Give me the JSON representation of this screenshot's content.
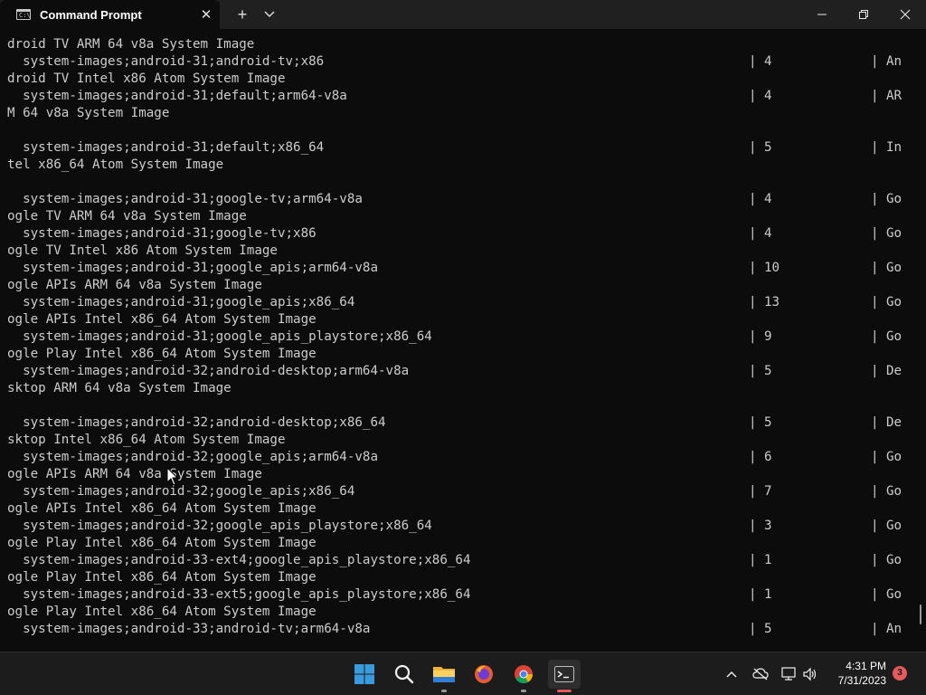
{
  "titlebar": {
    "tab_title": "Command Prompt",
    "tab_icon_text": "C:\\",
    "close_tab_glyph": "✕",
    "new_tab_glyph": "+",
    "dropdown_glyph": "⌄",
    "minimize_glyph": "—",
    "maximize_glyph": "❐",
    "close_glyph": "✕"
  },
  "terminal": {
    "lines": [
      {
        "text": "droid TV ARM 64 v8a System Image"
      },
      {
        "text": "  system-images;android-31;android-tv;x86",
        "count": "4",
        "desc": "An"
      },
      {
        "text": "droid TV Intel x86 Atom System Image"
      },
      {
        "text": "  system-images;android-31;default;arm64-v8a",
        "count": "4",
        "desc": "AR"
      },
      {
        "text": "M 64 v8a System Image"
      },
      {
        "text": ""
      },
      {
        "text": "  system-images;android-31;default;x86_64",
        "count": "5",
        "desc": "In"
      },
      {
        "text": "tel x86_64 Atom System Image"
      },
      {
        "text": ""
      },
      {
        "text": "  system-images;android-31;google-tv;arm64-v8a",
        "count": "4",
        "desc": "Go"
      },
      {
        "text": "ogle TV ARM 64 v8a System Image"
      },
      {
        "text": "  system-images;android-31;google-tv;x86",
        "count": "4",
        "desc": "Go"
      },
      {
        "text": "ogle TV Intel x86 Atom System Image"
      },
      {
        "text": "  system-images;android-31;google_apis;arm64-v8a",
        "count": "10",
        "desc": "Go"
      },
      {
        "text": "ogle APIs ARM 64 v8a System Image"
      },
      {
        "text": "  system-images;android-31;google_apis;x86_64",
        "count": "13",
        "desc": "Go"
      },
      {
        "text": "ogle APIs Intel x86_64 Atom System Image"
      },
      {
        "text": "  system-images;android-31;google_apis_playstore;x86_64",
        "count": "9",
        "desc": "Go"
      },
      {
        "text": "ogle Play Intel x86_64 Atom System Image"
      },
      {
        "text": "  system-images;android-32;android-desktop;arm64-v8a",
        "count": "5",
        "desc": "De"
      },
      {
        "text": "sktop ARM 64 v8a System Image"
      },
      {
        "text": ""
      },
      {
        "text": "  system-images;android-32;android-desktop;x86_64",
        "count": "5",
        "desc": "De"
      },
      {
        "text": "sktop Intel x86_64 Atom System Image"
      },
      {
        "text": "  system-images;android-32;google_apis;arm64-v8a",
        "count": "6",
        "desc": "Go"
      },
      {
        "text": "ogle APIs ARM 64 v8a System Image"
      },
      {
        "text": "  system-images;android-32;google_apis;x86_64",
        "count": "7",
        "desc": "Go"
      },
      {
        "text": "ogle APIs Intel x86_64 Atom System Image"
      },
      {
        "text": "  system-images;android-32;google_apis_playstore;x86_64",
        "count": "3",
        "desc": "Go"
      },
      {
        "text": "ogle Play Intel x86_64 Atom System Image"
      },
      {
        "text": "  system-images;android-33-ext4;google_apis_playstore;x86_64",
        "count": "1",
        "desc": "Go"
      },
      {
        "text": "ogle Play Intel x86_64 Atom System Image"
      },
      {
        "text": "  system-images;android-33-ext5;google_apis_playstore;x86_64",
        "count": "1",
        "desc": "Go"
      },
      {
        "text": "ogle Play Intel x86_64 Atom System Image"
      },
      {
        "text": "  system-images;android-33;android-tv;arm64-v8a",
        "count": "5",
        "desc": "An"
      }
    ]
  },
  "taskbar": {
    "apps": [
      "windows-start-icon",
      "search-icon",
      "file-explorer-icon",
      "firefox-icon",
      "chrome-icon",
      "terminal-icon"
    ],
    "clock_time": "4:31 PM",
    "clock_date": "7/31/2023",
    "notification_count": "3"
  }
}
